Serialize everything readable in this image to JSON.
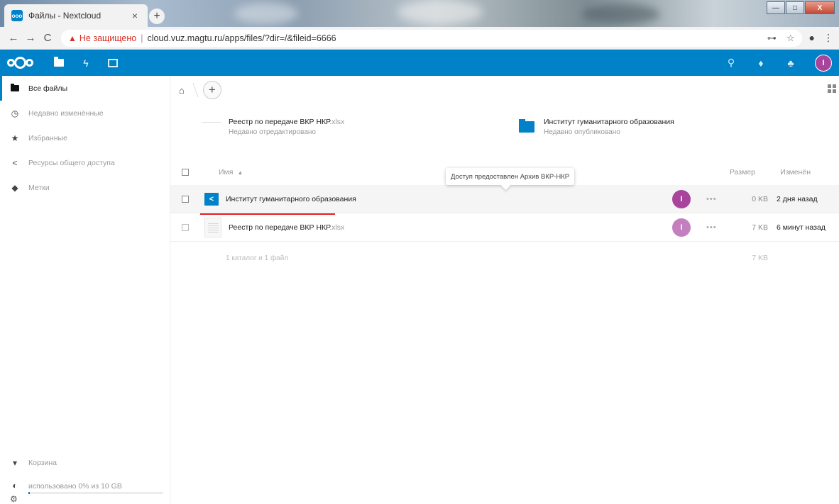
{
  "browser": {
    "tab_title": "Файлы - Nextcloud",
    "tab_close": "×",
    "new_tab": "+",
    "not_secure": "Не защищено",
    "url": "cloud.vuz.magtu.ru/apps/files/?dir=/&fileid=6666",
    "window_controls": {
      "minimize": "—",
      "maximize": "□",
      "close": "X"
    }
  },
  "header": {
    "accent_color": "#0082c9",
    "avatar_color": "#a9449c",
    "apps": [
      "files-icon",
      "activity-icon",
      "gallery-icon"
    ],
    "right_icons": [
      "search-icon",
      "notifications-icon",
      "contacts-icon"
    ],
    "avatar_initial": "I"
  },
  "sidebar": {
    "items": [
      {
        "label": "Все файлы",
        "icon": "folder-icon"
      },
      {
        "label": "Недавно изменённые",
        "icon": "clock-icon"
      },
      {
        "label": "Избранные",
        "icon": "star-icon"
      },
      {
        "label": "Ресурсы общего доступа",
        "icon": "share-icon"
      },
      {
        "label": "Метки",
        "icon": "tag-icon"
      }
    ],
    "trash_label": "Корзина",
    "quota_label": "использовано 0% из 10 GB",
    "quota_fraction": 0.0
  },
  "breadcrumb": {
    "home_icon": "home-icon",
    "add_label": "+"
  },
  "recent": [
    {
      "name": "Реестр по передаче ВКР НКР",
      "ext": ".xlsx",
      "status": "Недавно отредактировано",
      "kind": "file"
    },
    {
      "name": "Институт гуманитарного образования",
      "ext": "",
      "status": "Недавно опубликовано",
      "kind": "folder"
    }
  ],
  "table": {
    "headers": {
      "name": "Имя",
      "sort_indicator": "▲",
      "size": "Размер",
      "modified": "Изменён"
    },
    "rows": [
      {
        "name": "Институт гуманитарного образования",
        "ext": "",
        "size": "0 KB",
        "modified": "2 дня назад",
        "kind": "shared-folder"
      },
      {
        "name": "Реестр по передаче ВКР НКР",
        "ext": ".xlsx",
        "size": "7 KB",
        "modified": "6 минут назад",
        "kind": "xlsx"
      }
    ],
    "more_label": "•••",
    "share_avatar_initial": "I",
    "summary": {
      "label": "1 каталог и 1 файл",
      "size": "7 KB"
    }
  },
  "tooltip": "Доступ предоставлен Архив ВКР-НКР"
}
